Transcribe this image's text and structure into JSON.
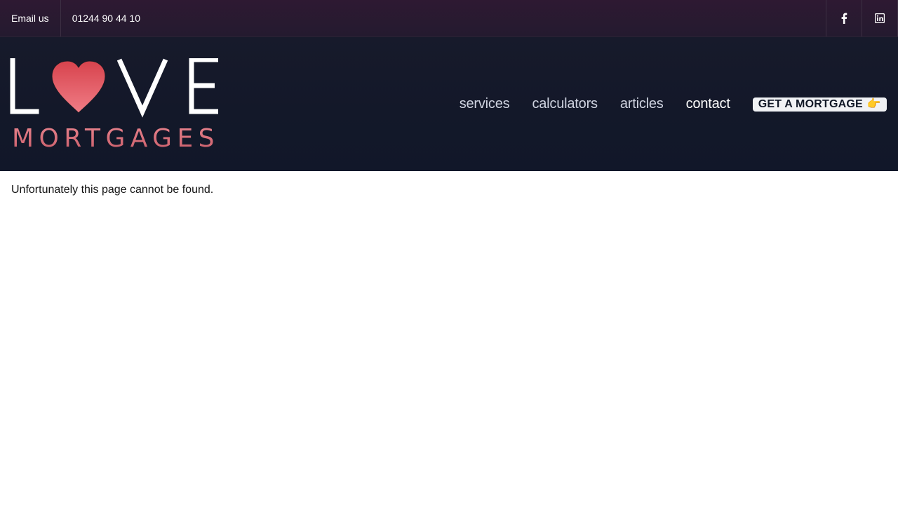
{
  "topbar": {
    "email_label": "Email us",
    "phone_label": "01244 90 44 10",
    "social": [
      {
        "icon": "facebook-icon"
      },
      {
        "icon": "linkedin-icon"
      }
    ]
  },
  "logo": {
    "word_top": "LOVE",
    "word_bottom": "MORTGAGES",
    "heart_color": "#e8626b"
  },
  "nav": {
    "items": [
      {
        "label": "services"
      },
      {
        "label": "calculators"
      },
      {
        "label": "articles"
      },
      {
        "label": "contact"
      }
    ],
    "cta_label": "GET A MORTGAGE",
    "cta_icon": "pointing-hand-icon"
  },
  "main": {
    "message": "Unfortunately this page cannot be found."
  },
  "colors": {
    "topbar_bg": "#2e1932",
    "header_bg": "#131829",
    "accent_pink": "#e07a86"
  }
}
